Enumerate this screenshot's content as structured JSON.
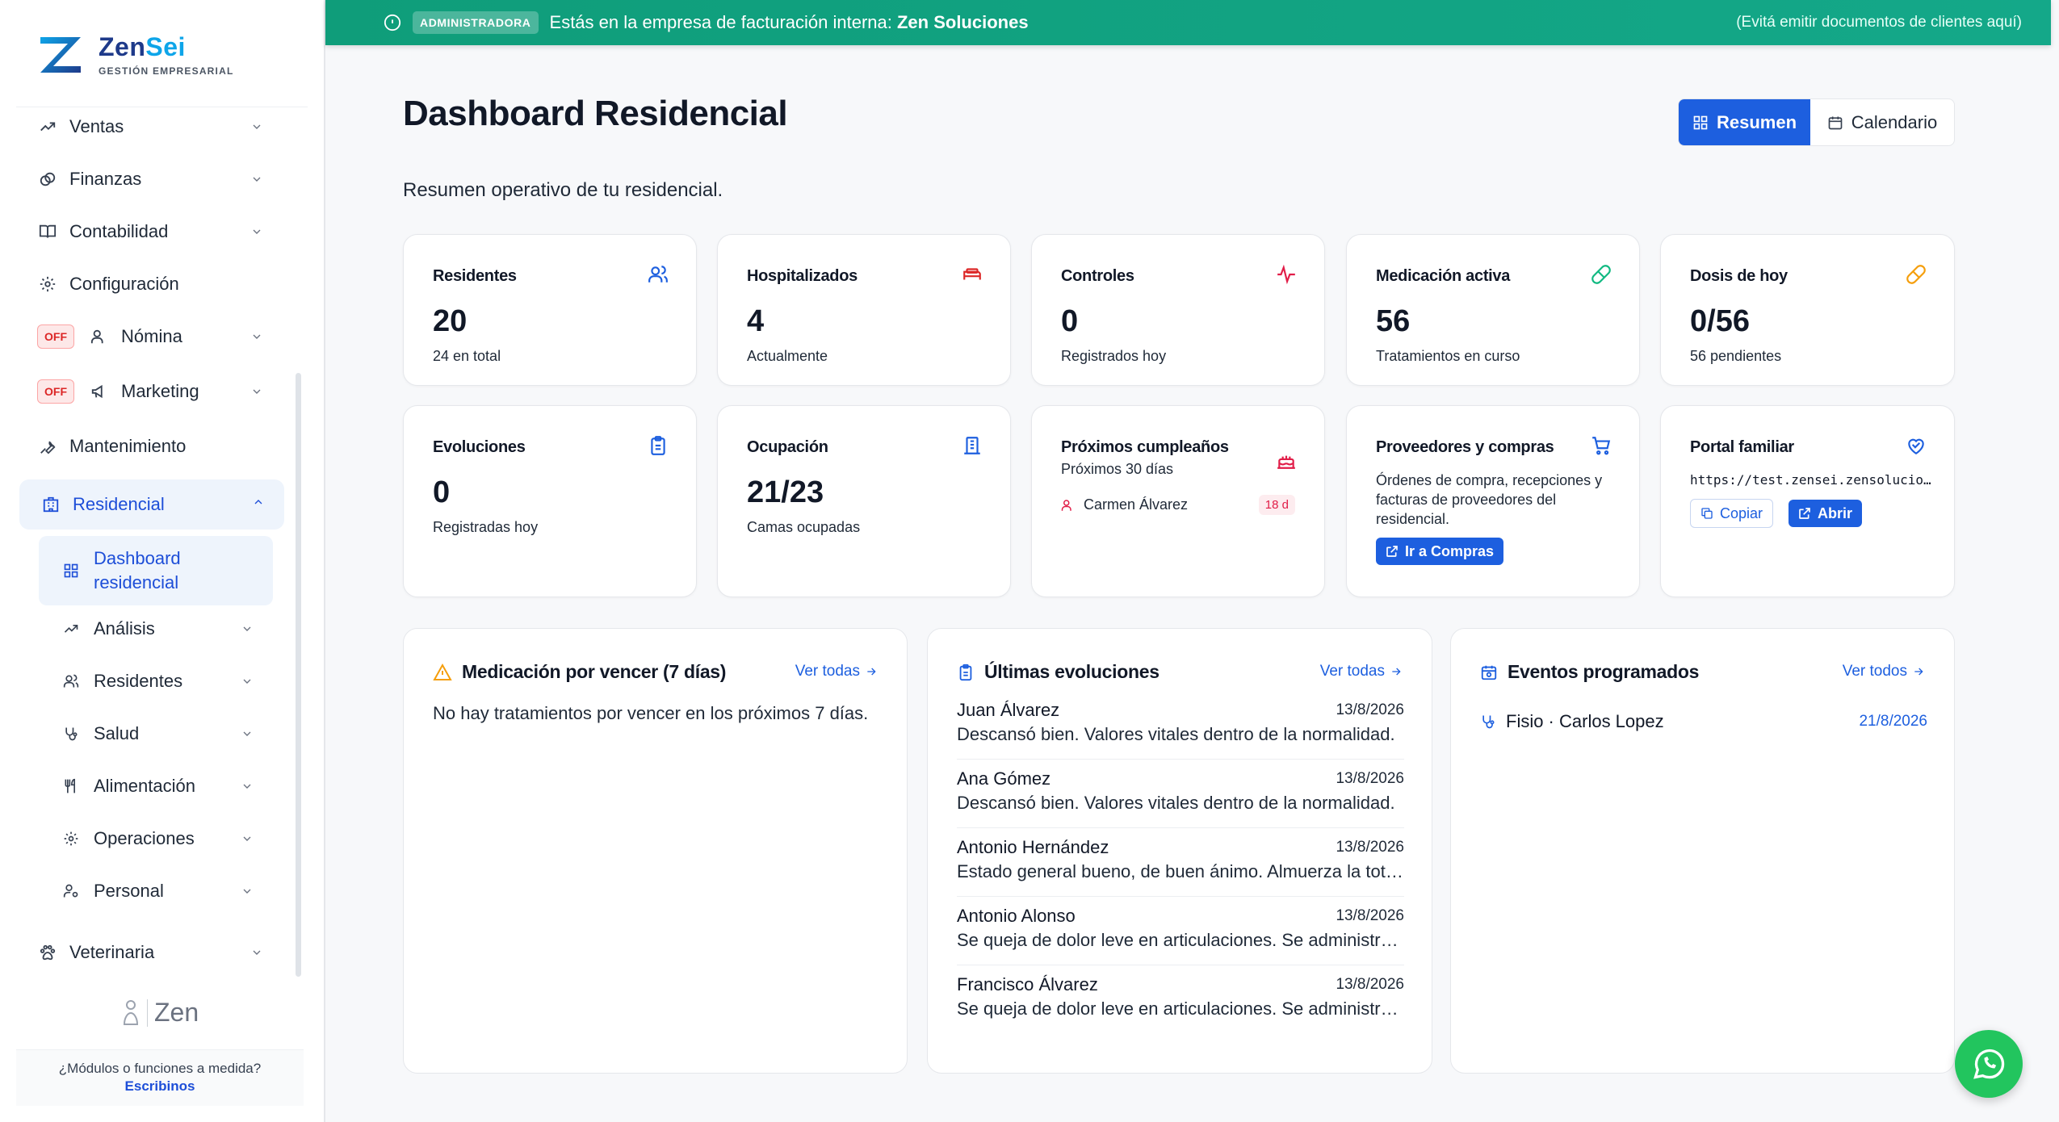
{
  "brand": {
    "name_part1": "Zen",
    "name_part2": "Sei",
    "tagline": "GESTIÓN EMPRESARIAL"
  },
  "banner": {
    "badge": "ADMINISTRADORA",
    "message_prefix": "Estás en la empresa de facturación interna: ",
    "company": "Zen Soluciones",
    "note": "(Evitá emitir documentos de clientes aquí)"
  },
  "sidebar": {
    "items": [
      {
        "label": "Ventas",
        "icon": "trending-up-icon"
      },
      {
        "label": "Finanzas",
        "icon": "coins-icon"
      },
      {
        "label": "Contabilidad",
        "icon": "book-icon"
      },
      {
        "label": "Configuración",
        "icon": "gear-icon"
      },
      {
        "label": "Nómina",
        "icon": "users-icon",
        "badge": "OFF"
      },
      {
        "label": "Marketing",
        "icon": "megaphone-icon",
        "badge": "OFF"
      },
      {
        "label": "Mantenimiento",
        "icon": "wrench-icon"
      },
      {
        "label": "Residencial",
        "icon": "building-icon"
      },
      {
        "label": "Veterinaria",
        "icon": "paw-icon"
      }
    ],
    "sub_items": [
      {
        "label": "Dashboard residencial",
        "icon": "dashboard-icon"
      },
      {
        "label": "Análisis",
        "icon": "trending-up-icon"
      },
      {
        "label": "Residentes",
        "icon": "users-icon"
      },
      {
        "label": "Salud",
        "icon": "stethoscope-icon"
      },
      {
        "label": "Alimentación",
        "icon": "utensils-icon"
      },
      {
        "label": "Operaciones",
        "icon": "gear-icon"
      },
      {
        "label": "Personal",
        "icon": "user-cog-icon"
      }
    ],
    "footer_logo": "Zen",
    "help_text": "¿Módulos o funciones a medida?",
    "help_link": "Escribinos"
  },
  "header": {
    "title": "Dashboard Residencial",
    "subtitle": "Resumen operativo de tu residencial.",
    "view_resumen": "Resumen",
    "view_calendario": "Calendario"
  },
  "stats": [
    {
      "label": "Residentes",
      "value": "20",
      "sub": "24 en total",
      "icon": "users-icon",
      "color": "#1d5fdf"
    },
    {
      "label": "Hospitalizados",
      "value": "4",
      "sub": "Actualmente",
      "icon": "bed-icon",
      "color": "#dc2626"
    },
    {
      "label": "Controles",
      "value": "0",
      "sub": "Registrados hoy",
      "icon": "activity-icon",
      "color": "#e11d48"
    },
    {
      "label": "Medicación activa",
      "value": "56",
      "sub": "Tratamientos en curso",
      "icon": "pill-icon",
      "color": "#10b981"
    },
    {
      "label": "Dosis de hoy",
      "value": "0/56",
      "sub": "56 pendientes",
      "icon": "pill-icon",
      "color": "#f59e0b"
    },
    {
      "label": "Evoluciones",
      "value": "0",
      "sub": "Registradas hoy",
      "icon": "clipboard-icon",
      "color": "#1d5fdf"
    },
    {
      "label": "Ocupación",
      "value": "21/23",
      "sub": "Camas ocupadas",
      "icon": "building-icon",
      "color": "#1d5fdf"
    }
  ],
  "birthdays": {
    "label": "Próximos cumpleaños",
    "sub": "Próximos 30 días",
    "icon": "cake-icon",
    "entries": [
      {
        "name": "Carmen Álvarez",
        "days": "18 d"
      }
    ]
  },
  "suppliers": {
    "label": "Proveedores y compras",
    "desc": "Órdenes de compra, recepciones y facturas de proveedores del residencial.",
    "button": "Ir a Compras",
    "icon": "cart-icon"
  },
  "portal": {
    "label": "Portal familiar",
    "url": "https://test.zensei.zensoluciones.com/portal",
    "copy": "Copiar",
    "open": "Abrir",
    "icon": "heart-icon"
  },
  "panels": {
    "medication": {
      "title": "Medicación por vencer (7 días)",
      "link": "Ver todas",
      "empty": "No hay tratamientos por vencer en los próximos 7 días."
    },
    "evolutions": {
      "title": "Últimas evoluciones",
      "link": "Ver todas",
      "items": [
        {
          "name": "Juan Álvarez",
          "date": "13/8/2026",
          "text": "Descansó bien. Valores vitales dentro de la normalidad."
        },
        {
          "name": "Ana Gómez",
          "date": "13/8/2026",
          "text": "Descansó bien. Valores vitales dentro de la normalidad."
        },
        {
          "name": "Antonio Hernández",
          "date": "13/8/2026",
          "text": "Estado general bueno, de buen ánimo. Almuerza la totalidad."
        },
        {
          "name": "Antonio Alonso",
          "date": "13/8/2026",
          "text": "Se queja de dolor leve en articulaciones. Se administró analgésico."
        },
        {
          "name": "Francisco Álvarez",
          "date": "13/8/2026",
          "text": "Se queja de dolor leve en articulaciones. Se administró analgésico."
        }
      ]
    },
    "events": {
      "title": "Eventos programados",
      "link": "Ver todos",
      "items": [
        {
          "name": "Fisio · Carlos Lopez",
          "date": "21/8/2026"
        }
      ]
    }
  }
}
